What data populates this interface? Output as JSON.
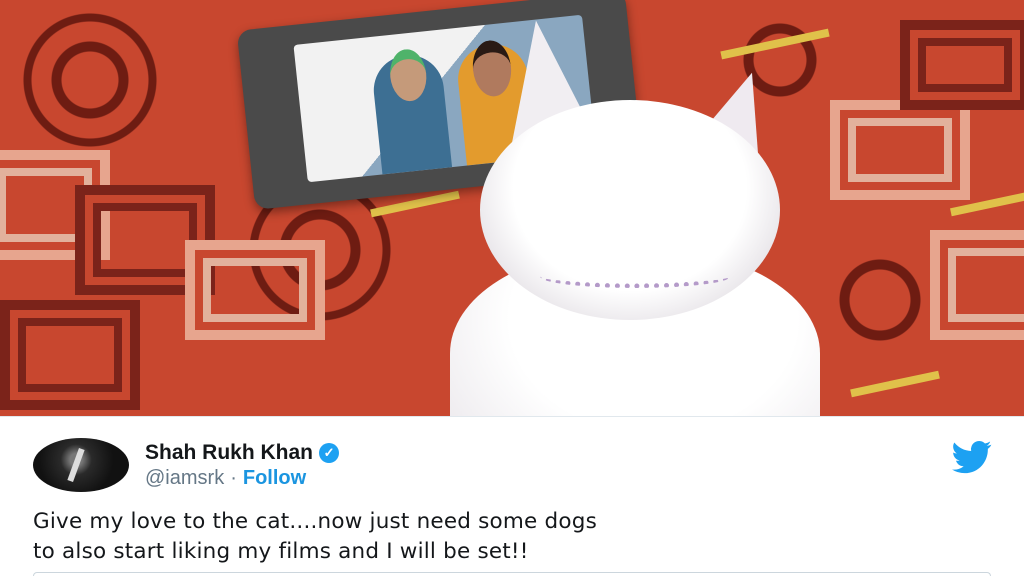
{
  "tweet": {
    "author_name": "Shah Rukh Khan",
    "handle": "@iamsrk",
    "separator": "·",
    "follow_label": "Follow",
    "verified_glyph": "✓",
    "text_line1": "Give my love to the cat....now just need some dogs",
    "text_line2": "to also start liking my films and I will be set!!",
    "icons": {
      "platform": "twitter-bird-icon",
      "verified": "verified-badge-icon"
    },
    "colors": {
      "brand": "#1da1f2",
      "follow": "#1b95e0",
      "text": "#14171a",
      "muted": "#657786"
    }
  }
}
